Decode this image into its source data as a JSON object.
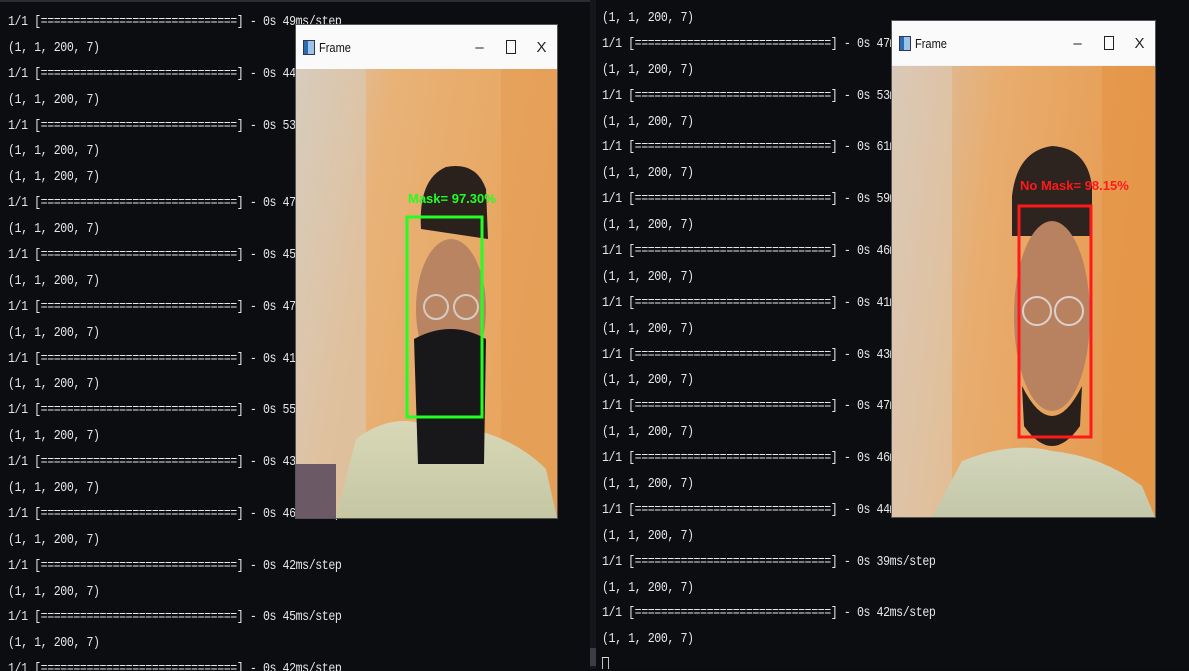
{
  "left_terminal": {
    "lines": [
      "1/1 [==============================] - 0s 49ms/step",
      "(1, 1, 200, 7)",
      "1/1 [==============================] - 0s 44ms/step",
      "(1, 1, 200, 7)",
      "1/1 [==============================] - 0s 53ms/step",
      "(1, 1, 200, 7)",
      "(1, 1, 200, 7)",
      "1/1 [==============================] - 0s 47ms/step",
      "(1, 1, 200, 7)",
      "1/1 [==============================] - 0s 45ms/step",
      "(1, 1, 200, 7)",
      "1/1 [==============================] - 0s 47ms/step",
      "(1, 1, 200, 7)",
      "1/1 [==============================] - 0s 41ms/step",
      "(1, 1, 200, 7)",
      "1/1 [==============================] - 0s 55ms/step",
      "(1, 1, 200, 7)",
      "1/1 [==============================] - 0s 43ms/step",
      "(1, 1, 200, 7)",
      "1/1 [==============================] - 0s 46ms/step",
      "(1, 1, 200, 7)",
      "1/1 [==============================] - 0s 42ms/step",
      "(1, 1, 200, 7)",
      "1/1 [==============================] - 0s 45ms/step",
      "(1, 1, 200, 7)",
      "1/1 [==============================] - 0s 42ms/step"
    ]
  },
  "right_terminal": {
    "lines": [
      "(1, 1, 200, 7)",
      "1/1 [==============================] - 0s 47ms/step",
      "(1, 1, 200, 7)",
      "1/1 [==============================] - 0s 53ms/step",
      "(1, 1, 200, 7)",
      "1/1 [==============================] - 0s 61ms/step",
      "(1, 1, 200, 7)",
      "1/1 [==============================] - 0s 59ms/step",
      "(1, 1, 200, 7)",
      "1/1 [==============================] - 0s 46ms/step",
      "(1, 1, 200, 7)",
      "1/1 [==============================] - 0s 41ms/step",
      "(1, 1, 200, 7)",
      "1/1 [==============================] - 0s 43ms/step",
      "(1, 1, 200, 7)",
      "1/1 [==============================] - 0s 47ms/step",
      "(1, 1, 200, 7)",
      "1/1 [==============================] - 0s 46ms/step",
      "(1, 1, 200, 7)",
      "1/1 [==============================] - 0s 44ms/step",
      "(1, 1, 200, 7)",
      "1/1 [==============================] - 0s 39ms/step",
      "(1, 1, 200, 7)",
      "1/1 [==============================] - 0s 42ms/step",
      "(1, 1, 200, 7)"
    ]
  },
  "window_left": {
    "title": "Frame",
    "minimize_glyph": "–",
    "close_glyph": "X",
    "app_icon": "window-app-icon",
    "detection": {
      "label": "Mask= 97.30%",
      "color": "#22ff22"
    }
  },
  "window_right": {
    "title": "Frame",
    "minimize_glyph": "–",
    "close_glyph": "X",
    "app_icon": "window-app-icon",
    "detection": {
      "label": "No Mask= 98.15%",
      "color": "#ff1a1a"
    }
  }
}
